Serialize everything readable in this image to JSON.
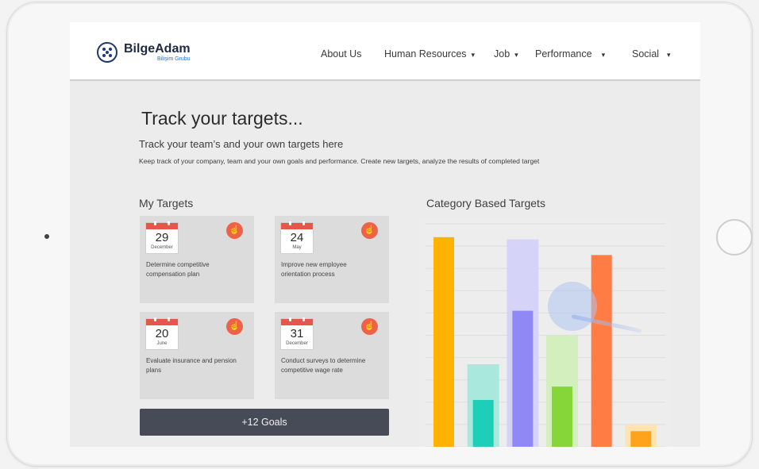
{
  "brand": {
    "name": "BilgeAdam",
    "subtitle": "Bilişim Grubu",
    "color": "#1e3a6e"
  },
  "nav": {
    "about": "About Us",
    "human_resources": "Human Resources",
    "job": "Job",
    "performance": "Performance",
    "social": "Social",
    "caret": "▾"
  },
  "page": {
    "title": "Track your targets...",
    "subtitle": "Track your team’s and your own targets here",
    "description": "Keep track of your company, team and your own goals and performance. Create new targets, analyze the results of completed target"
  },
  "my_targets": {
    "title": "My Targets",
    "cards": [
      {
        "day": "29",
        "month": "December",
        "text": "Determine competitive compensation plan",
        "icon": "hand-pointer-icon"
      },
      {
        "day": "24",
        "month": "May",
        "text": "Improve new employee orientation process",
        "icon": "hand-pointer-icon"
      },
      {
        "day": "20",
        "month": "June",
        "text": "Evaluate insurance and pension plans",
        "icon": "hand-pointer-icon"
      },
      {
        "day": "31",
        "month": "December",
        "text": "Conduct surveys to determine competitive wage rate",
        "icon": "hand-pointer-icon"
      }
    ],
    "more_button": "+12 Goals"
  },
  "category_targets": {
    "title": "Category Based Targets"
  },
  "chart_data": {
    "type": "bar",
    "title": "",
    "categories": [
      "",
      "",
      "",
      "",
      "",
      ""
    ],
    "ylim": [
      0,
      100
    ],
    "grid": true,
    "series": [
      {
        "values": [
          0,
          37,
          93,
          50,
          0,
          10
        ],
        "colors": [
          "#ffc21a",
          "#a9e8dd",
          "#d5d3f7",
          "#d2efbd",
          "#fcd3bc",
          "#ffe3b0"
        ]
      },
      {
        "values": [
          94,
          21,
          61,
          27,
          86,
          7
        ],
        "colors": [
          "#ffb300",
          "#1ccfb6",
          "#9088f4",
          "#86d63a",
          "#ff7d45",
          "#ffa21c"
        ]
      }
    ]
  },
  "colors": {
    "accent": "#ef6248",
    "button": "#474a57"
  }
}
